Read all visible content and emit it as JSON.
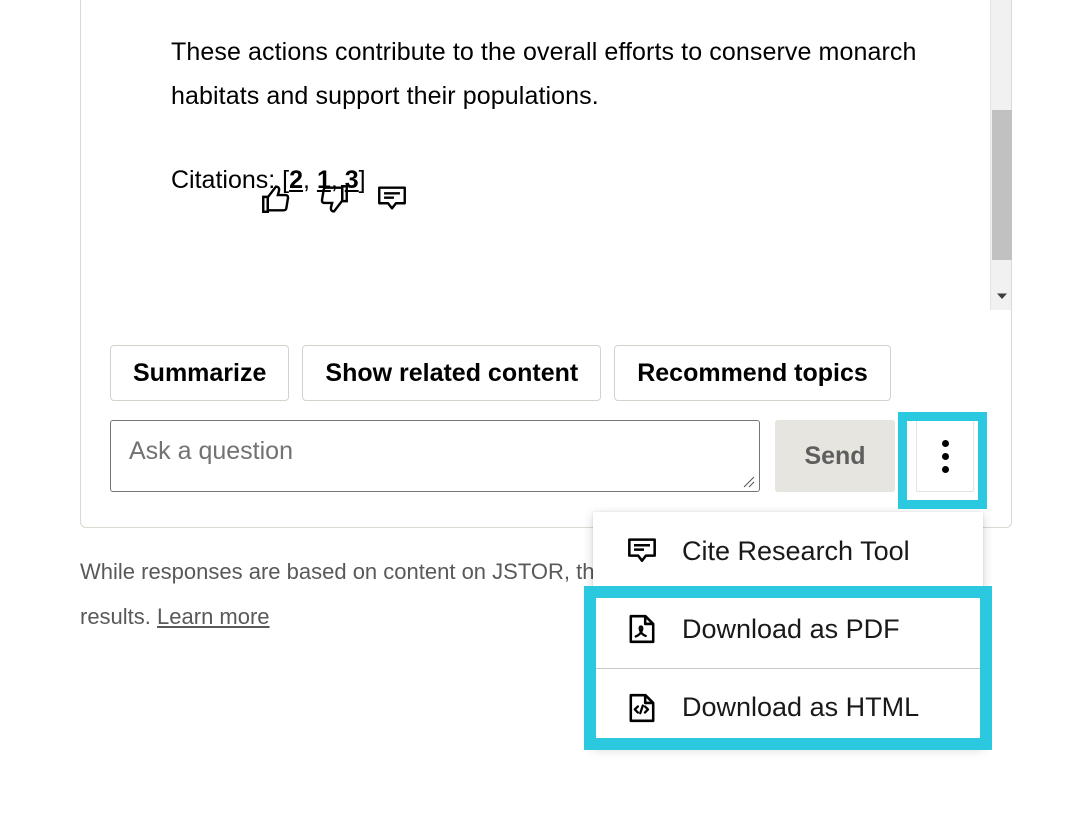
{
  "chat": {
    "message_paragraphs": [
      "These actions contribute to the overall efforts to conserve monarch habitats and support their populations."
    ],
    "citations_label": "Citations:",
    "citations_open_bracket": "[",
    "citations_close_bracket": "]",
    "citations": [
      "2",
      "1",
      "3"
    ],
    "citations_separator": ", ",
    "feedback": [
      {
        "icon": "thumbs-up-icon",
        "name": "thumbs-up"
      },
      {
        "icon": "thumbs-down-icon",
        "name": "thumbs-down"
      },
      {
        "icon": "comment-feedback-icon",
        "name": "leave-feedback"
      }
    ]
  },
  "suggestions": [
    {
      "label": "Summarize"
    },
    {
      "label": "Show related content"
    },
    {
      "label": "Recommend topics"
    }
  ],
  "input": {
    "placeholder": "Ask a question",
    "value": "",
    "send_label": "Send",
    "kebab_icon": "more-options-icon"
  },
  "menu": {
    "items": [
      {
        "label": "Cite Research Tool",
        "icon": "cite-research-tool-icon"
      },
      {
        "label": "Download as PDF",
        "icon": "pdf-file-icon"
      },
      {
        "label": "Download as HTML",
        "icon": "html-file-icon"
      }
    ]
  },
  "disclaimer": {
    "text_before_link": "While responses are based on content on JSTOR, they may produce biased or inaccurate results. ",
    "link_label": "Learn more",
    "text_after_link": ""
  },
  "scrollbar": {
    "down_arrow_icon": "chevron-down-icon"
  },
  "colors": {
    "highlight_cyan": "#2AC9E0",
    "send_button_bg": "#E7E5DF",
    "send_button_text": "#5E5E5E",
    "scroll_thumb": "#C1C1C1"
  }
}
